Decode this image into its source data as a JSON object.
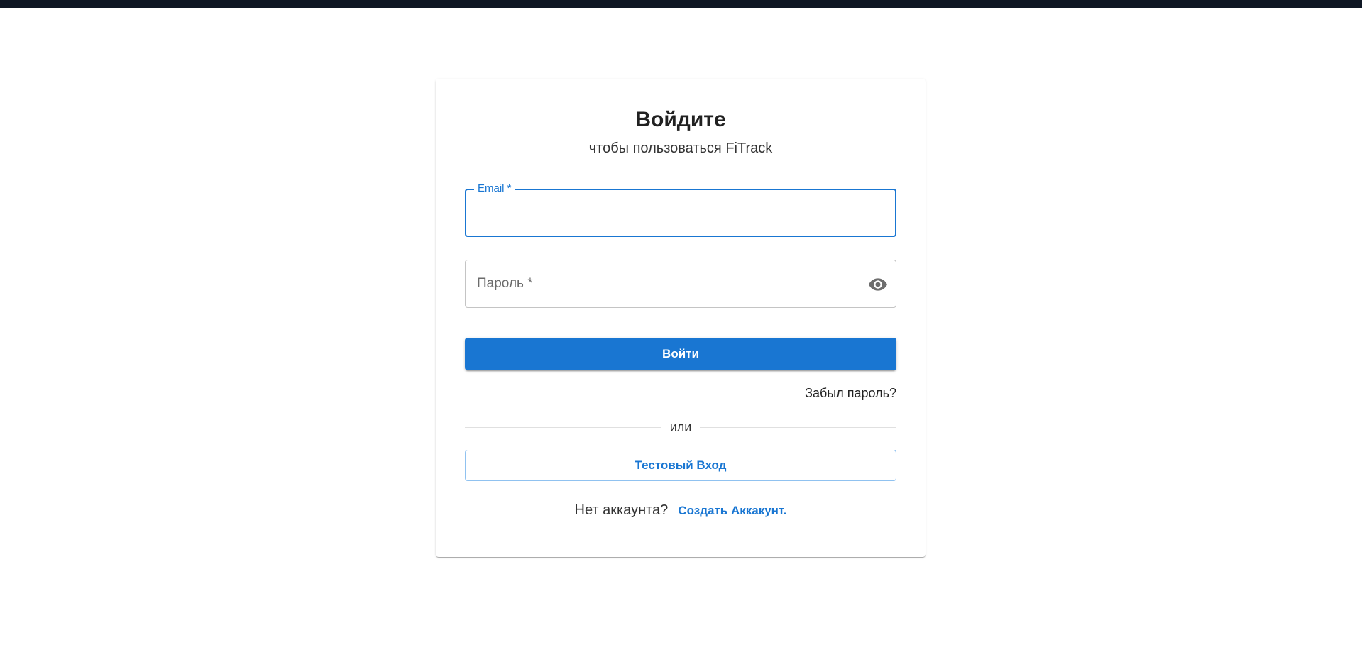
{
  "login": {
    "title": "Войдите",
    "subtitle": "чтобы пользоваться FiTrack",
    "email": {
      "label": "Email *",
      "value": ""
    },
    "password": {
      "placeholder": "Пароль *",
      "value": "",
      "toggle_icon": "eye-icon"
    },
    "submit_label": "Войти",
    "forgot_label": "Забыл пароль?",
    "divider_label": "или",
    "test_login_label": "Тестовый Вход",
    "no_account_text": "Нет аккаунта?",
    "create_account_label": "Создать Аккакунт."
  },
  "colors": {
    "primary": "#1976d2",
    "top_bar": "#0f1724"
  }
}
